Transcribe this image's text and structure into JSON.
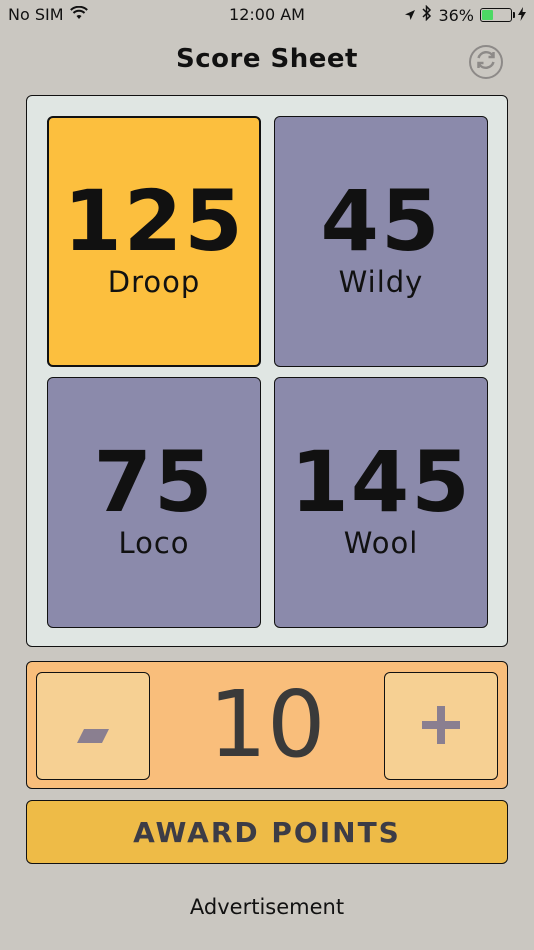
{
  "status_bar": {
    "carrier": "No SIM",
    "time": "12:00 AM",
    "battery": "36%"
  },
  "header": {
    "title": "Score Sheet",
    "reset_icon": "refresh-icon"
  },
  "players": [
    {
      "score": "125",
      "name": "Droop",
      "selected": true
    },
    {
      "score": "45",
      "name": "Wildy",
      "selected": false
    },
    {
      "score": "75",
      "name": "Loco",
      "selected": false
    },
    {
      "score": "145",
      "name": "Wool",
      "selected": false
    }
  ],
  "stepper": {
    "minus_label": "-",
    "value": "10",
    "plus_label": "+"
  },
  "award_button": {
    "label": "AWARD POINTS"
  },
  "ad": {
    "label": "Advertisement"
  },
  "colors": {
    "background": "#cac7c1",
    "selected_card": "#fcbf3e",
    "card": "#8b8aab",
    "stepper_panel": "#f9be7b",
    "award": "#eebb47",
    "battery_fill": "#4cd964"
  }
}
